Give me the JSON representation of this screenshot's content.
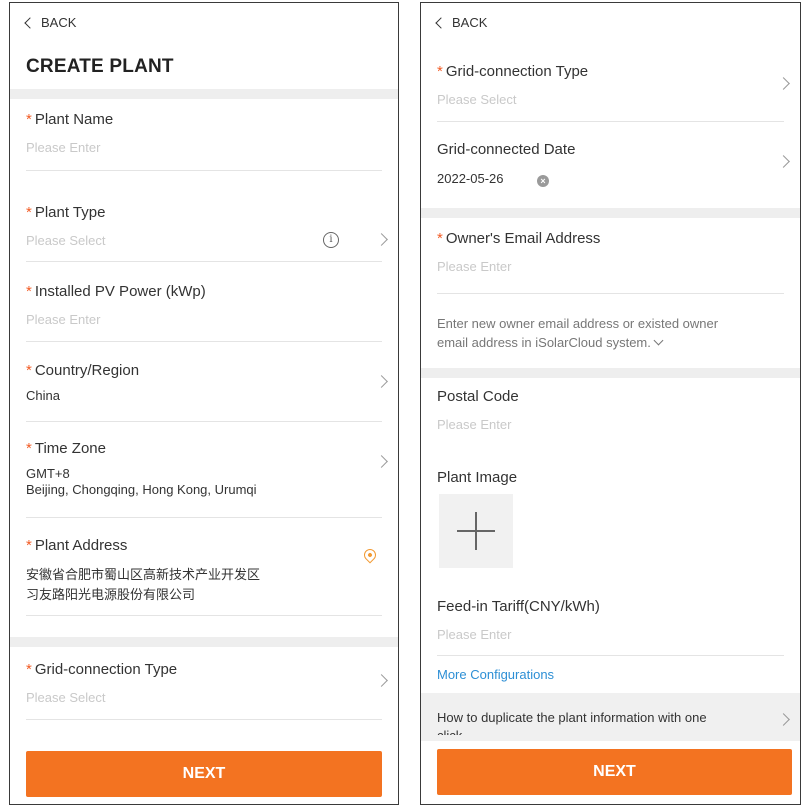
{
  "left": {
    "back_label": "BACK",
    "title": "CREATE PLANT",
    "fields": {
      "plant_name": {
        "label": "Plant Name",
        "placeholder": "Please Enter"
      },
      "plant_type": {
        "label": "Plant Type",
        "placeholder": "Please Select"
      },
      "pv_power": {
        "label": "Installed PV Power (kWp)",
        "placeholder": "Please Enter"
      },
      "country": {
        "label": "Country/Region",
        "value": "China"
      },
      "time_zone": {
        "label": "Time Zone",
        "value_line1": "GMT+8",
        "value_line2": "Beijing, Chongqing, Hong Kong, Urumqi"
      },
      "address": {
        "label": "Plant Address",
        "value_line1": "安徽省合肥市蜀山区高新技术产业开发区",
        "value_line2": "习友路阳光电源股份有限公司"
      },
      "grid_type": {
        "label": "Grid-connection Type",
        "placeholder": "Please Select"
      }
    },
    "required_mark": "*",
    "next_label": "NEXT"
  },
  "right": {
    "back_label": "BACK",
    "fields": {
      "grid_type": {
        "label": "Grid-connection Type",
        "placeholder": "Please Select"
      },
      "grid_date": {
        "label": "Grid-connected Date",
        "value": "2022-05-26"
      },
      "owner_email": {
        "label": "Owner's Email Address",
        "placeholder": "Please Enter",
        "hint_line1": "Enter new owner email address or existed owner",
        "hint_line2": "email address in iSolarCloud system."
      },
      "postal_code": {
        "label": "Postal Code",
        "placeholder": "Please Enter"
      },
      "plant_image": {
        "label": "Plant Image"
      },
      "feed_in_tariff": {
        "label": "Feed-in Tariff(CNY/kWh)",
        "placeholder": "Please Enter"
      }
    },
    "more_configurations": "More Configurations",
    "duplicate_text_line1": "How to duplicate the plant information with one",
    "duplicate_text_line2": "click",
    "required_mark": "*",
    "next_label": "NEXT"
  },
  "colors": {
    "accent": "#f37321",
    "required": "#f25c26",
    "link": "#2d8fd5",
    "pin": "#f29a33"
  },
  "icons": [
    "chevron-left-icon",
    "chevron-right-icon",
    "info-icon",
    "location-pin-icon",
    "clear-icon",
    "plus-icon",
    "caret-down-icon"
  ]
}
